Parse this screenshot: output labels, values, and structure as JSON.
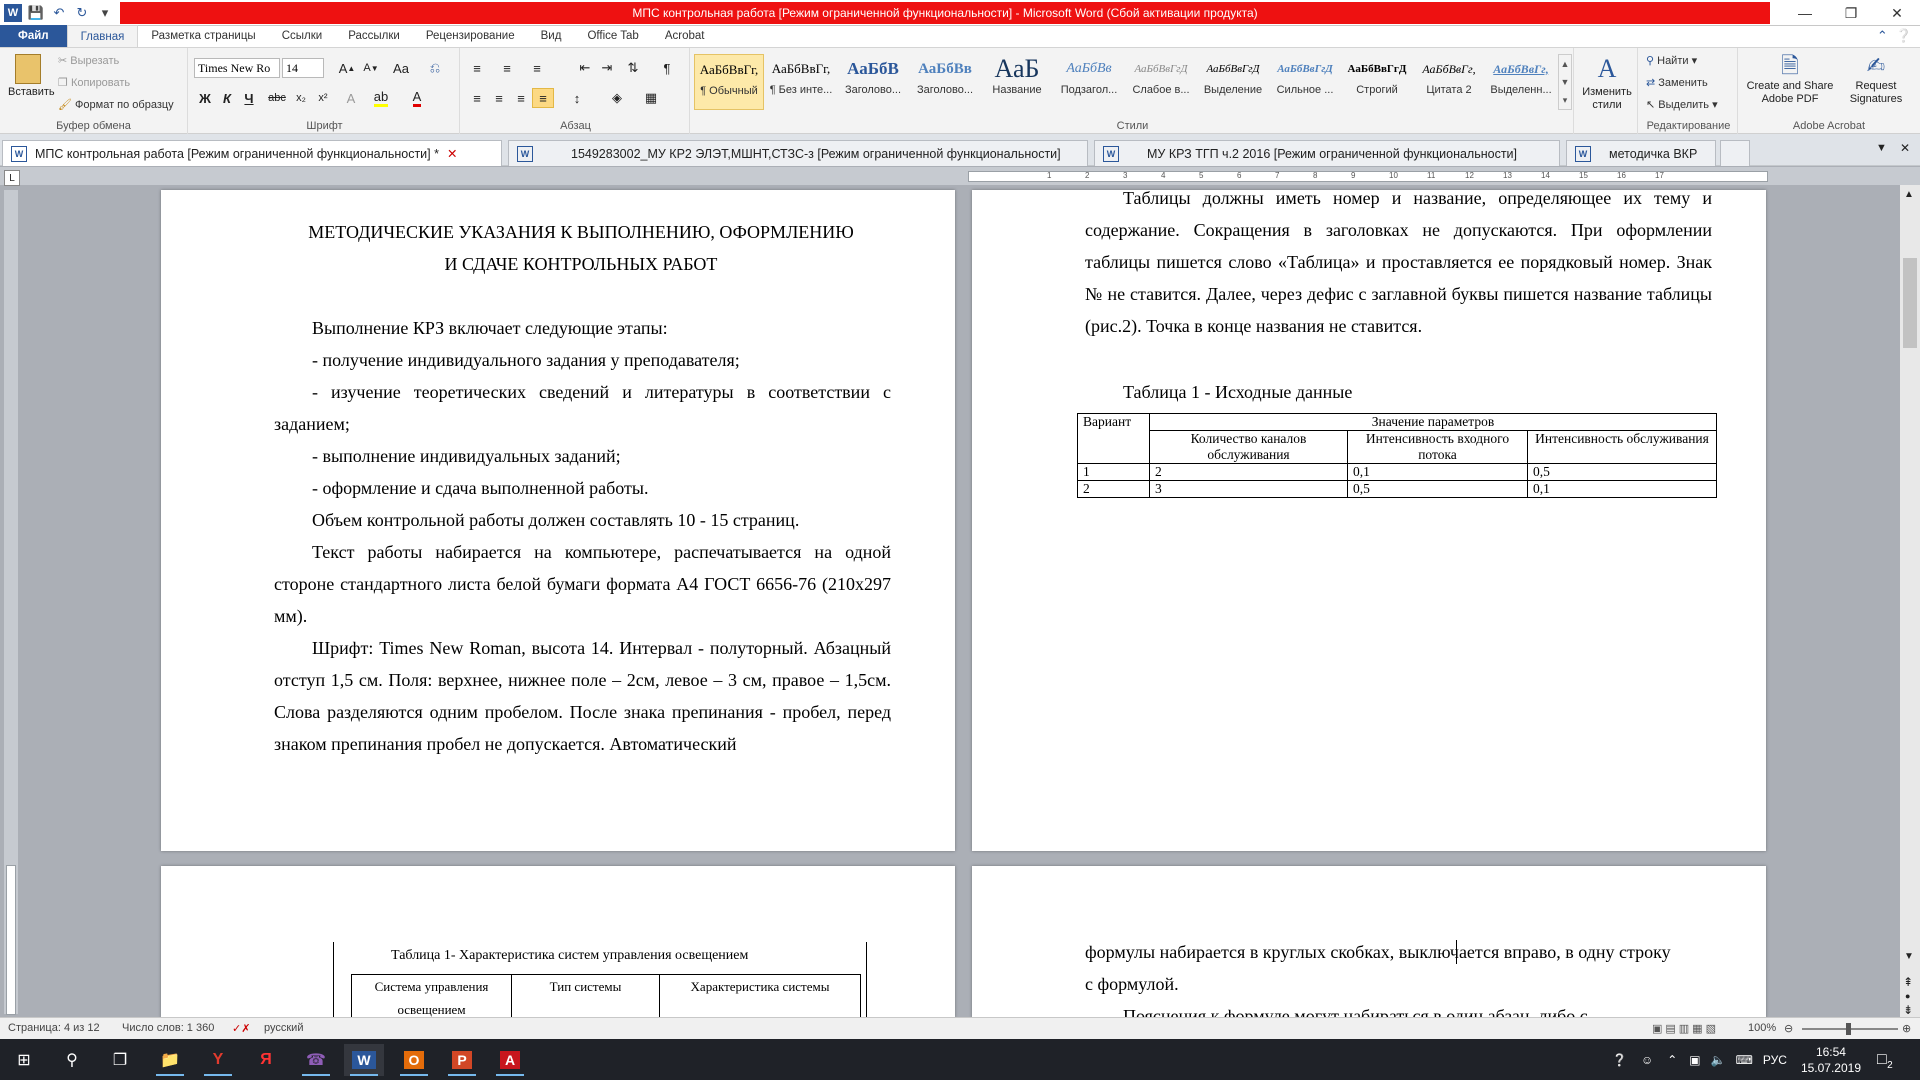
{
  "window": {
    "title": "МПС контрольная работа [Режим ограниченной функциональности]  -  Microsoft Word (Сбой активации продукта)"
  },
  "ribbon_tabs": [
    "Файл",
    "Главная",
    "Разметка страницы",
    "Ссылки",
    "Рассылки",
    "Рецензирование",
    "Вид",
    "Office Tab",
    "Acrobat"
  ],
  "clipboard": {
    "paste": "Вставить",
    "cut": "Вырезать",
    "copy": "Копировать",
    "format_painter": "Формат по образцу",
    "label": "Буфер обмена"
  },
  "font": {
    "name": "Times New Ro",
    "size": "14",
    "label": "Шрифт"
  },
  "paragraph": {
    "label": "Абзац"
  },
  "styles": {
    "label": "Стили",
    "items": [
      {
        "preview": "АаБбВвГг,",
        "name": "¶ Обычный"
      },
      {
        "preview": "АаБбВвГг,",
        "name": "¶ Без инте..."
      },
      {
        "preview": "АаБбВ",
        "name": "Заголово..."
      },
      {
        "preview": "АаБбВв",
        "name": "Заголово..."
      },
      {
        "preview": "АаБ",
        "name": "Название"
      },
      {
        "preview": "АаБбВв",
        "name": "Подзагол..."
      },
      {
        "preview": "АаБбВвГгД",
        "name": "Слабое в..."
      },
      {
        "preview": "АаБбВвГгД",
        "name": "Выделение"
      },
      {
        "preview": "АаБбВвГгД",
        "name": "Сильное ..."
      },
      {
        "preview": "АаБбВвГгД",
        "name": "Строгий"
      },
      {
        "preview": "АаБбВвГг,",
        "name": "Цитата 2"
      },
      {
        "preview": "АаБбВвГг,",
        "name": "Выделенн..."
      }
    ],
    "change": "Изменить стили"
  },
  "editing": {
    "find": "Найти",
    "replace": "Заменить",
    "select": "Выделить",
    "label": "Редактирование"
  },
  "acrobat": {
    "create": "Create and Share Adobe PDF",
    "request": "Request Signatures",
    "label": "Adobe Acrobat"
  },
  "doc_tabs": [
    "МПС контрольная работа [Режим ограниченной функциональности] *",
    "1549283002_МУ КР2 ЭЛЭТ,МШНТ,СТЗС-з [Режим ограниченной функциональности]",
    "МУ КРЗ ТГП ч.2 2016 [Режим ограниченной функциональности]",
    "методичка ВКР"
  ],
  "page1": {
    "heading1": "МЕТОДИЧЕСКИЕ УКАЗАНИЯ К ВЫПОЛНЕНИЮ, ОФОРМЛЕНИЮ",
    "heading2": "И СДАЧЕ КОНТРОЛЬНЫХ РАБОТ",
    "p_intro": "Выполнение КРЗ включает следующие этапы:",
    "li1": "- получение индивидуального задания у преподавателя;",
    "li2": "- изучение теоретических сведений и литературы в соответствии с заданием;",
    "li3": "- выполнение индивидуальных заданий;",
    "li4": "- оформление и сдача выполненной работы.",
    "p_volume": "Объем контрольной работы должен составлять 10 - 15 страниц.",
    "p_text": "Текст работы набирается на компьютере, распечатывается на одной стороне стандартного листа белой бумаги формата А4 ГОСТ 6656-76 (210х297 мм).",
    "p_font": "Шрифт: Times New Roman, высота 14. Интервал - полуторный. Абзацный отступ 1,5 см. Поля: верхнее, нижнее поле – 2см,  левое – 3 см, правое – 1,5см. Слова разделяются одним пробелом. После знака препинания - пробел, перед знаком препинания пробел не допускается. Автоматический"
  },
  "page2": {
    "p_tables": "Таблицы должны иметь номер и название, определяющее их тему и содержание. Сокращения в заголовках не допускаются. При оформлении таблицы пишется слово «Таблица» и проставляется ее порядковый номер. Знак № не ставится. Далее, через дефис с заглавной буквы пишется название таблицы (рис.2). Точка в конце названия не ставится.",
    "table_caption": "Таблица 1 - Исходные данные",
    "table": {
      "h_variant": "Вариант",
      "h_params": "Значение параметров",
      "h_c1": "Количество каналов обслуживания",
      "h_c2": "Интенсивность входного потока",
      "h_c3": "Интенсивность обслуживания",
      "rows": [
        [
          "1",
          "2",
          "0,1",
          "0,5"
        ],
        [
          "2",
          "3",
          "0,5",
          "0,1"
        ]
      ]
    }
  },
  "page3": {
    "table_caption": "Таблица 1- Характеристика систем управления освещением",
    "h1": "Система управления освещением",
    "h2": "Тип системы",
    "h3": "Характеристика системы"
  },
  "page4": {
    "line1": "формулы набирается в круглых скобках, выключается вправо, в одну строку",
    "line2": "с формулой.",
    "line3": "Пояснения к формуле могут набираться в один абзац, либо с"
  },
  "status": {
    "page": "Страница: 4 из 12",
    "words": "Число слов: 1 360",
    "lang": "русский",
    "zoom": "100%"
  },
  "tray": {
    "lang": "РУС",
    "time": "16:54",
    "date": "15.07.2019",
    "notif": "2"
  },
  "colors": {
    "accent": "#2b579a",
    "title_red": "#ee1111",
    "taskbar": "#1f2228"
  }
}
